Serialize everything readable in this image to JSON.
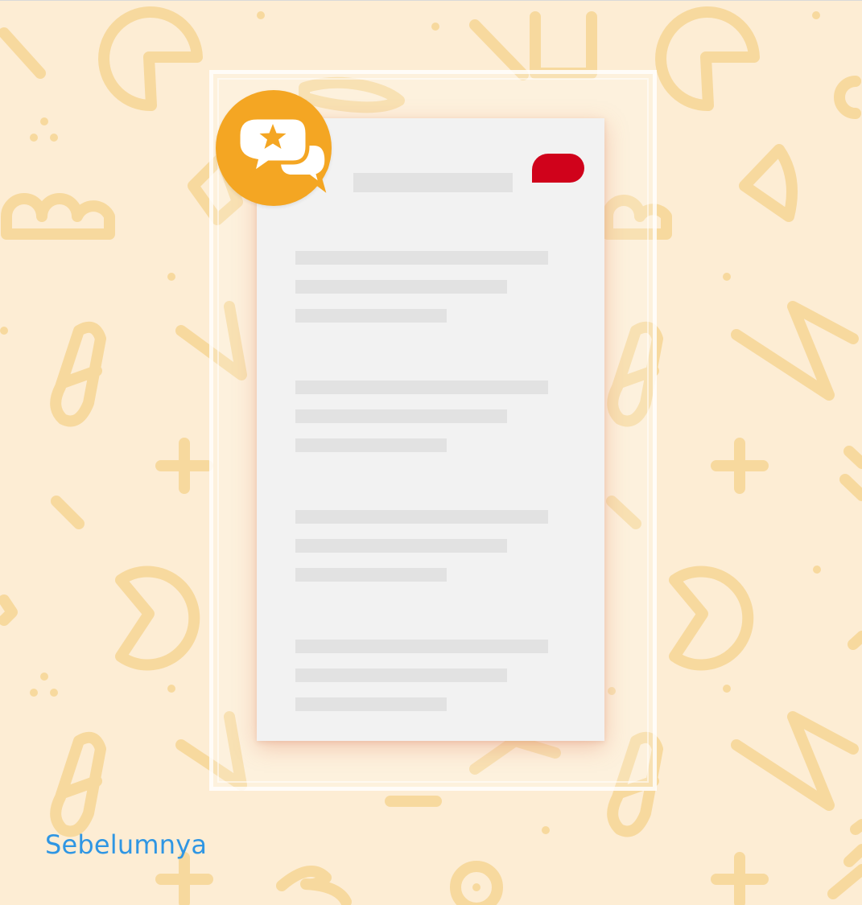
{
  "colors": {
    "background": "#FDEDD4",
    "pattern": "#F7D99E",
    "badge": "#F4A623",
    "accent_red": "#D0021B",
    "card": "#F2F2F2",
    "link": "#2F96E3"
  },
  "badge": {
    "icon": "chat-bubbles-star-icon"
  },
  "card": {
    "header_indicator": "red-pill",
    "line_groups": 4
  },
  "navigation": {
    "previous_label": "Sebelumnya"
  }
}
